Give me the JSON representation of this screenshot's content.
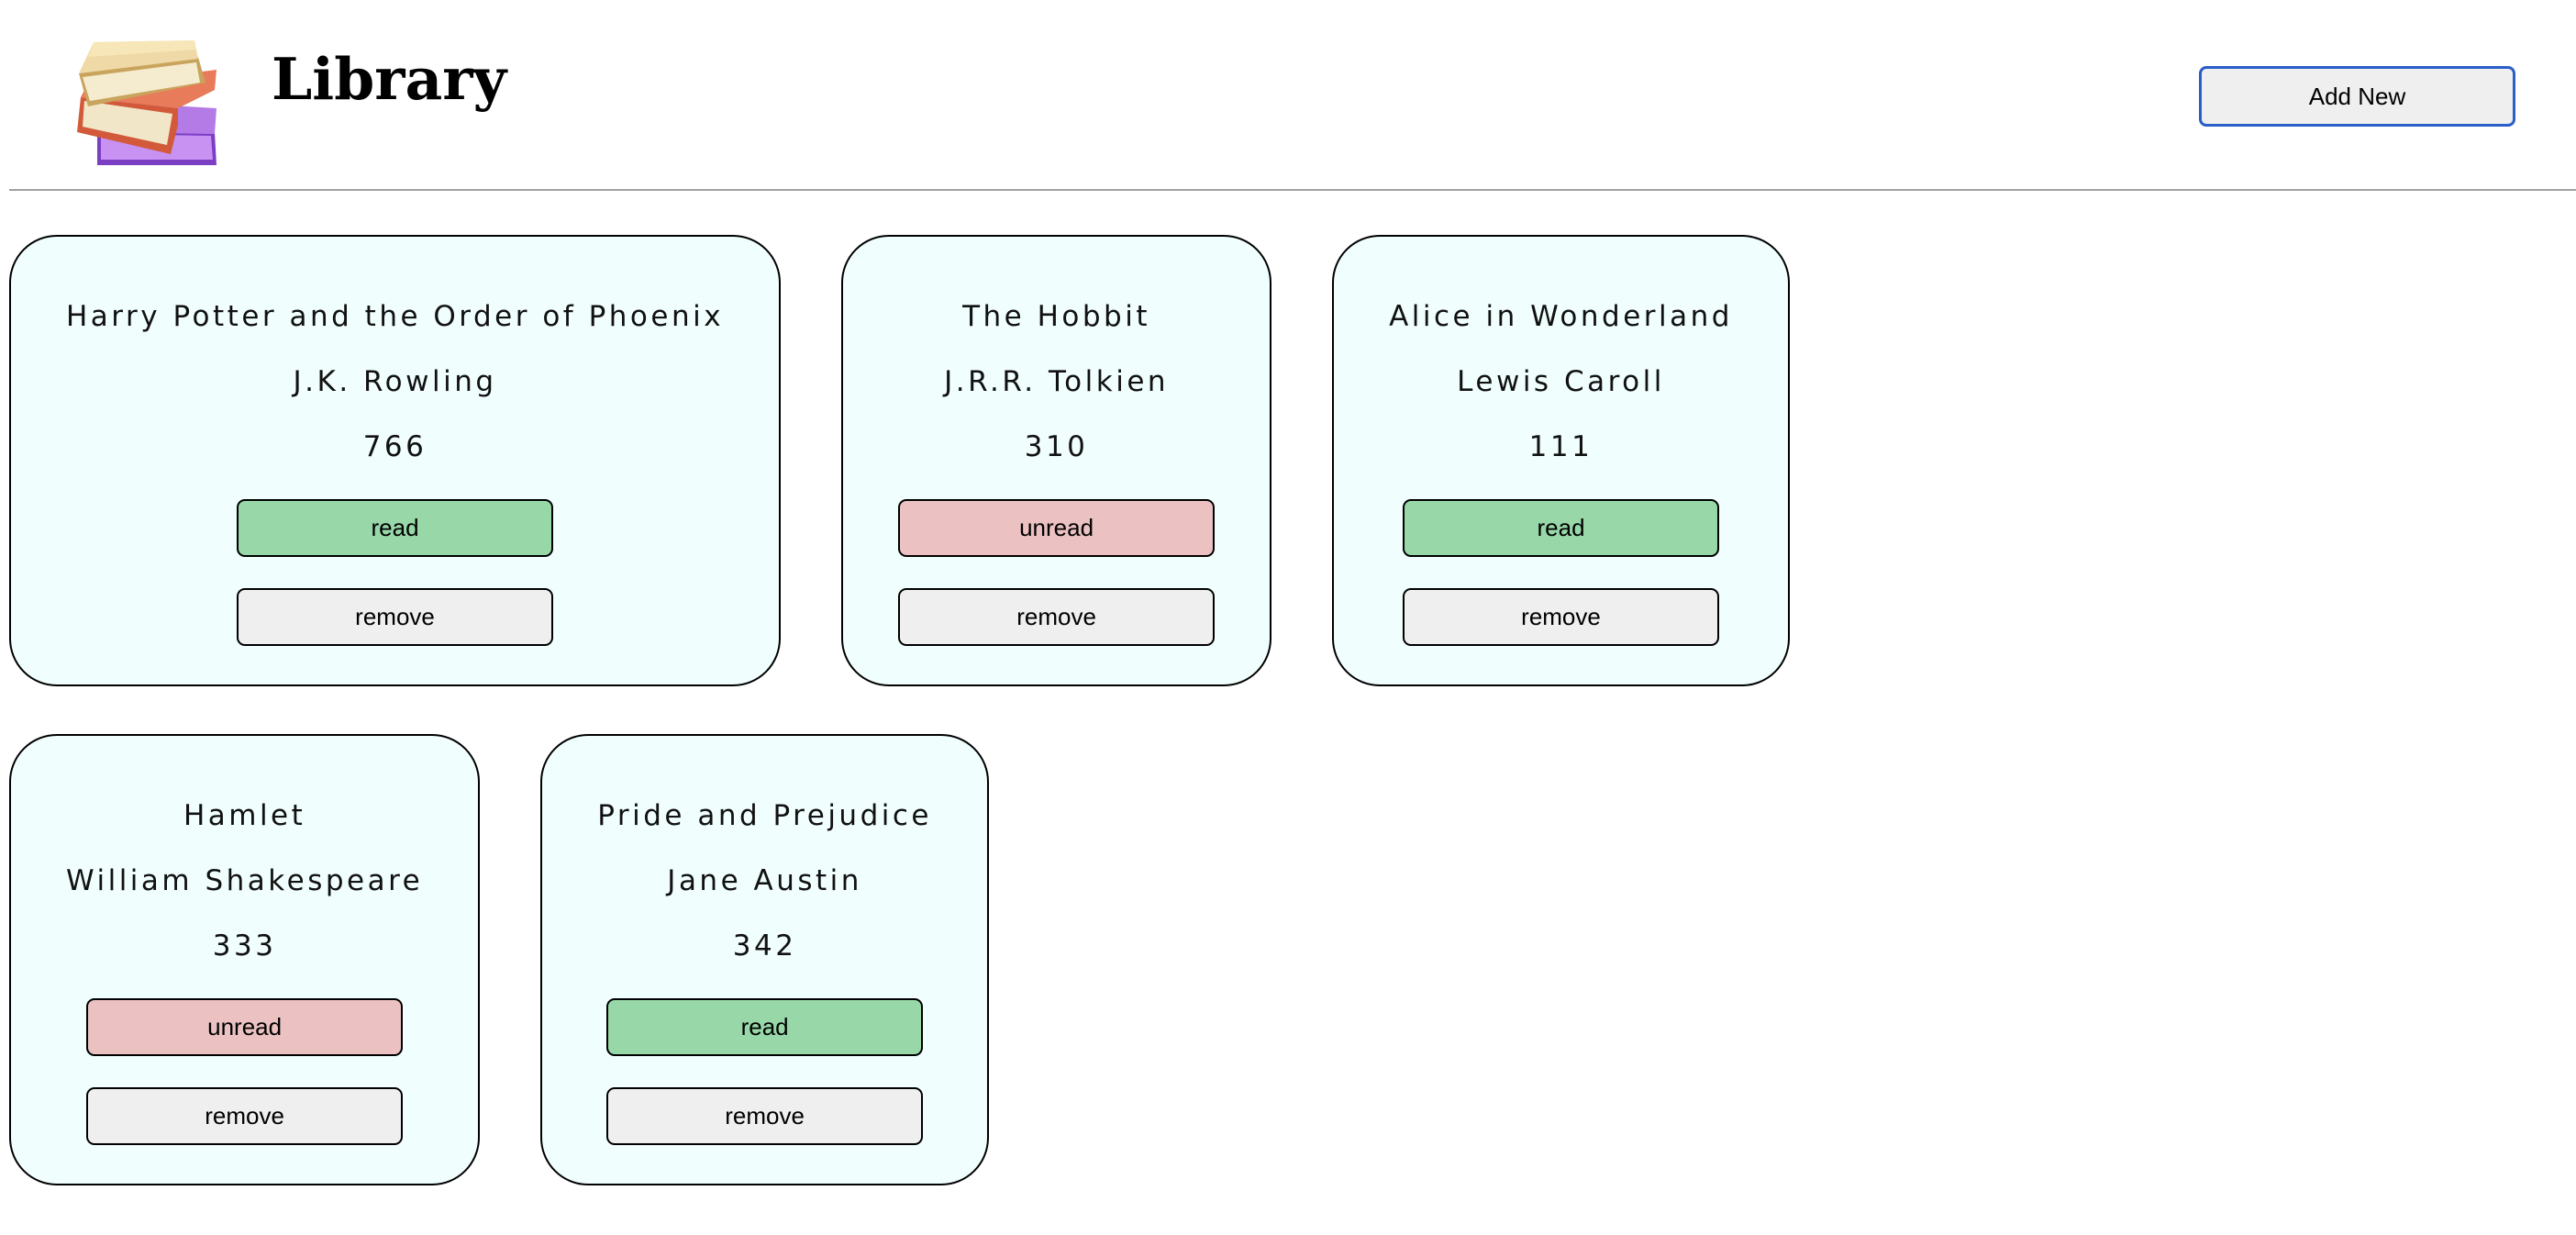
{
  "header": {
    "title": "Library",
    "logo_icon": "books-stack-icon",
    "add_new_label": "Add New"
  },
  "colors": {
    "read": "#98d8a8",
    "unread": "#ebc1c1",
    "card_background": "#f0fffe",
    "button_background": "#efefef",
    "add_new_border": "#2a5ec8"
  },
  "books": [
    {
      "title": "Harry Potter and the Order of Phoenix",
      "author": "J.K. Rowling",
      "pages": "766",
      "status": "read",
      "remove_label": "remove"
    },
    {
      "title": "The Hobbit",
      "author": "J.R.R. Tolkien",
      "pages": "310",
      "status": "unread",
      "remove_label": "remove"
    },
    {
      "title": "Alice in Wonderland",
      "author": "Lewis Caroll",
      "pages": "111",
      "status": "read",
      "remove_label": "remove"
    },
    {
      "title": "Hamlet",
      "author": "William Shakespeare",
      "pages": "333",
      "status": "unread",
      "remove_label": "remove"
    },
    {
      "title": "Pride and Prejudice",
      "author": "Jane Austin",
      "pages": "342",
      "status": "read",
      "remove_label": "remove"
    }
  ]
}
